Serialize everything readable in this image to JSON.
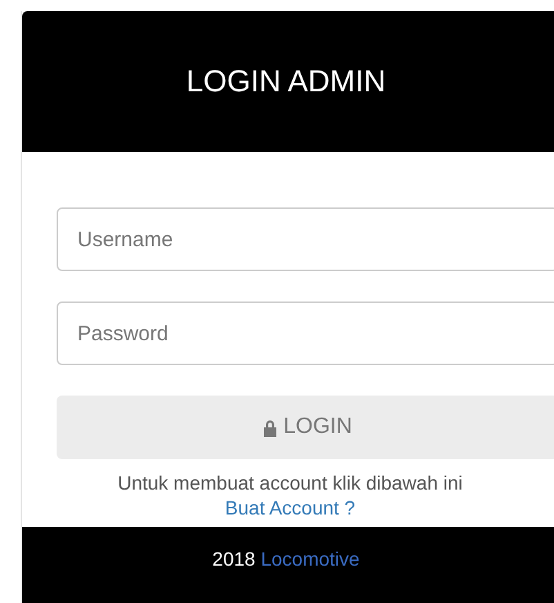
{
  "header": {
    "title": "LOGIN ADMIN"
  },
  "fields": [
    {
      "placeholder": "Username"
    },
    {
      "placeholder": "Password"
    }
  ],
  "login_button": {
    "label": "LOGIN"
  },
  "hint": "Untuk membuat account klik dibawah ini",
  "register_link": "Buat Account ?",
  "footer": {
    "year": "2018",
    "brand": "Locomotive"
  }
}
